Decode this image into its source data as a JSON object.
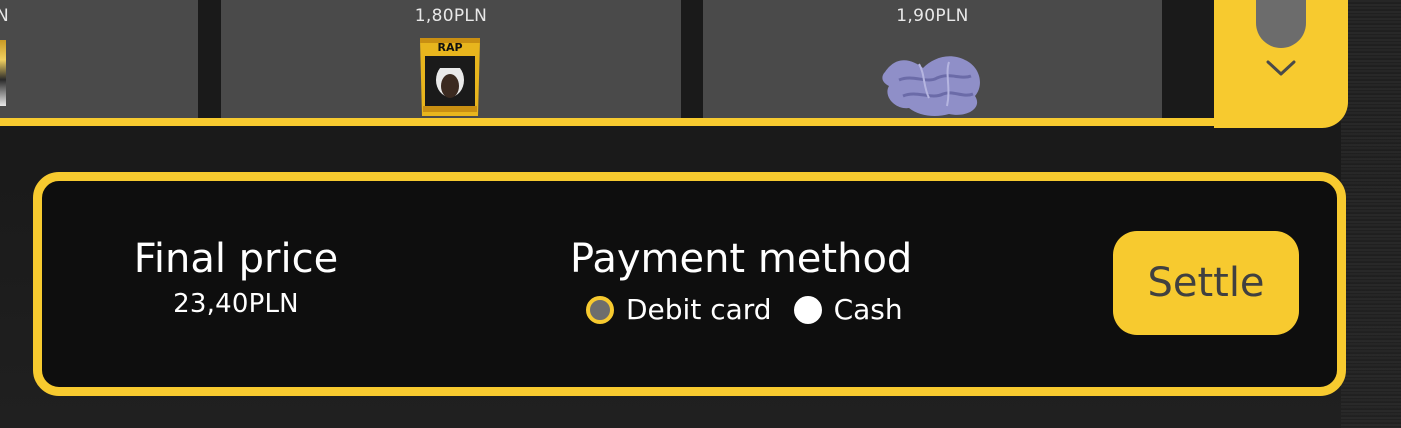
{
  "colors": {
    "accent": "#f7ca2f",
    "background": "#1b1b1b",
    "card": "#4a4a4a",
    "panel": "#0e0e0e",
    "text": "#ffffff"
  },
  "products": [
    {
      "price": "N",
      "thumb_icon": "product-image-partial"
    },
    {
      "price": "1,80PLN",
      "thumb_icon": "chips-bag-image",
      "thumb_text_top": "RAP"
    },
    {
      "price": "1,90PLN",
      "thumb_icon": "cloth-rag-image"
    }
  ],
  "scroll": {
    "down_icon": "chevron-down-icon"
  },
  "summary": {
    "final_title": "Final price",
    "final_value": "23,40PLN",
    "payment_title": "Payment method",
    "options": [
      {
        "label": "Debit card",
        "selected": true
      },
      {
        "label": "Cash",
        "selected": false
      }
    ],
    "settle_label": "Settle"
  }
}
